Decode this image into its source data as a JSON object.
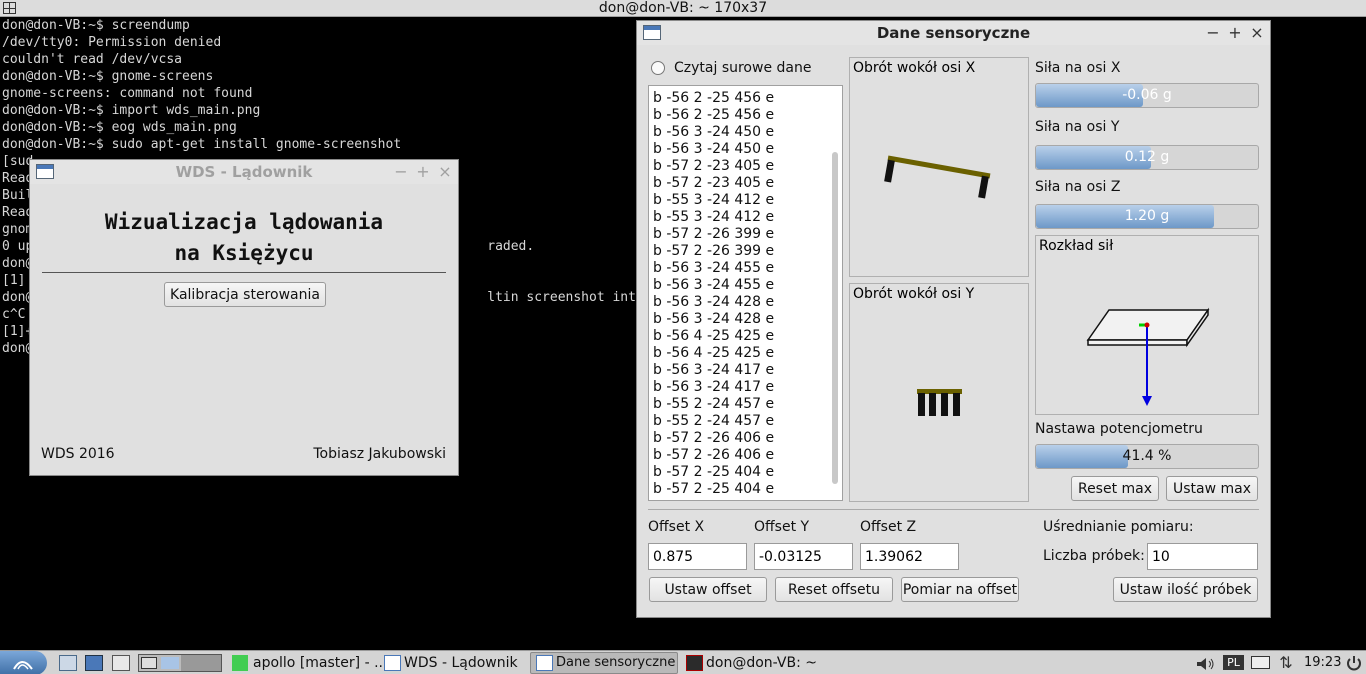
{
  "topbar": {
    "title": "don@don-VB: ~ 170x37"
  },
  "terminal": {
    "lines": [
      "don@don-VB:~$ screendump",
      "/dev/tty0: Permission denied",
      "couldn't read /dev/vcsa",
      "don@don-VB:~$ gnome-screens",
      "gnome-screens: command not found",
      "don@don-VB:~$ import wds_main.png",
      "don@don-VB:~$ eog wds_main.png",
      "don@don-VB:~$ sudo apt-get install gnome-screenshot",
      "[sud",
      "Read",
      "Buil",
      "Read",
      "gnom",
      "0 up                                                          raded.",
      "don@",
      "[1]",
      "don@                                                          ltin screenshot interfa",
      "c^C",
      "[1]+",
      "don@"
    ]
  },
  "lander_window": {
    "title": "WDS - Lądownik",
    "heading_line1": "Wizualizacja lądowania",
    "heading_line2": "na Księżycu",
    "calibrate_button": "Kalibracja sterowania",
    "footer_left": "WDS 2016",
    "footer_right": "Tobiasz Jakubowski"
  },
  "sensor_window": {
    "title": "Dane sensoryczne",
    "raw_data_radio": "Czytaj surowe dane",
    "raw_lines": [
      "b -56 2 -25 456 e",
      "b -56 2 -25 456 e",
      "b -56 3 -24 450 e",
      "b -56 3 -24 450 e",
      "b -57 2 -23 405 e",
      "b -57 2 -23 405 e",
      "b -55 3 -24 412 e",
      "b -55 3 -24 412 e",
      "b -57 2 -26 399 e",
      "b -57 2 -26 399 e",
      "b -56 3 -24 455 e",
      "b -56 3 -24 455 e",
      "b -56 3 -24 428 e",
      "b -56 3 -24 428 e",
      "b -56 4 -25 425 e",
      "b -56 4 -25 425 e",
      "b -56 3 -24 417 e",
      "b -56 3 -24 417 e",
      "b -55 2 -24 457 e",
      "b -55 2 -24 457 e",
      "b -57 2 -26 406 e",
      "b -57 2 -26 406 e",
      "b -57 2 -25 404 e",
      "b -57 2 -25 404 e"
    ],
    "rot_x_title": "Obrót wokół osi X",
    "rot_y_title": "Obrót wokół osi Y",
    "force_x_label": "Siła na osi X",
    "force_x_text": "-0.06 g",
    "force_x_fill": 0.48,
    "force_y_label": "Siła na osi Y",
    "force_y_text": "0.12 g",
    "force_y_fill": 0.52,
    "force_z_label": "Siła na osi Z",
    "force_z_text": "1.20 g",
    "force_z_fill": 0.8,
    "forces_title": "Rozkład sił",
    "pot_label": "Nastawa potencjometru",
    "pot_text": "41.4 %",
    "pot_fill": 0.414,
    "reset_max": "Reset max",
    "set_max": "Ustaw max",
    "offset_x_label": "Offset X",
    "offset_y_label": "Offset Y",
    "offset_z_label": "Offset Z",
    "offset_x_value": "0.875",
    "offset_y_value": "-0.03125",
    "offset_z_value": "1.39062",
    "avg_label": "Uśrednianie pomiaru:",
    "samples_label": "Liczba próbek:",
    "samples_value": "10",
    "set_offset": "Ustaw offset",
    "reset_offset": "Reset offsetu",
    "measure_offset": "Pomiar na offset",
    "set_samples": "Ustaw ilość próbek"
  },
  "taskbar": {
    "task1": "apollo [master] - ...",
    "task2": "WDS - Lądownik",
    "task3": "Dane sensoryczne",
    "task4": "don@don-VB: ~",
    "kbd": "PL",
    "clock": "19:23"
  },
  "colors": {
    "accent_bar": "#6d98c8",
    "platform": "#6b6100",
    "arrow": "#0000e0"
  }
}
